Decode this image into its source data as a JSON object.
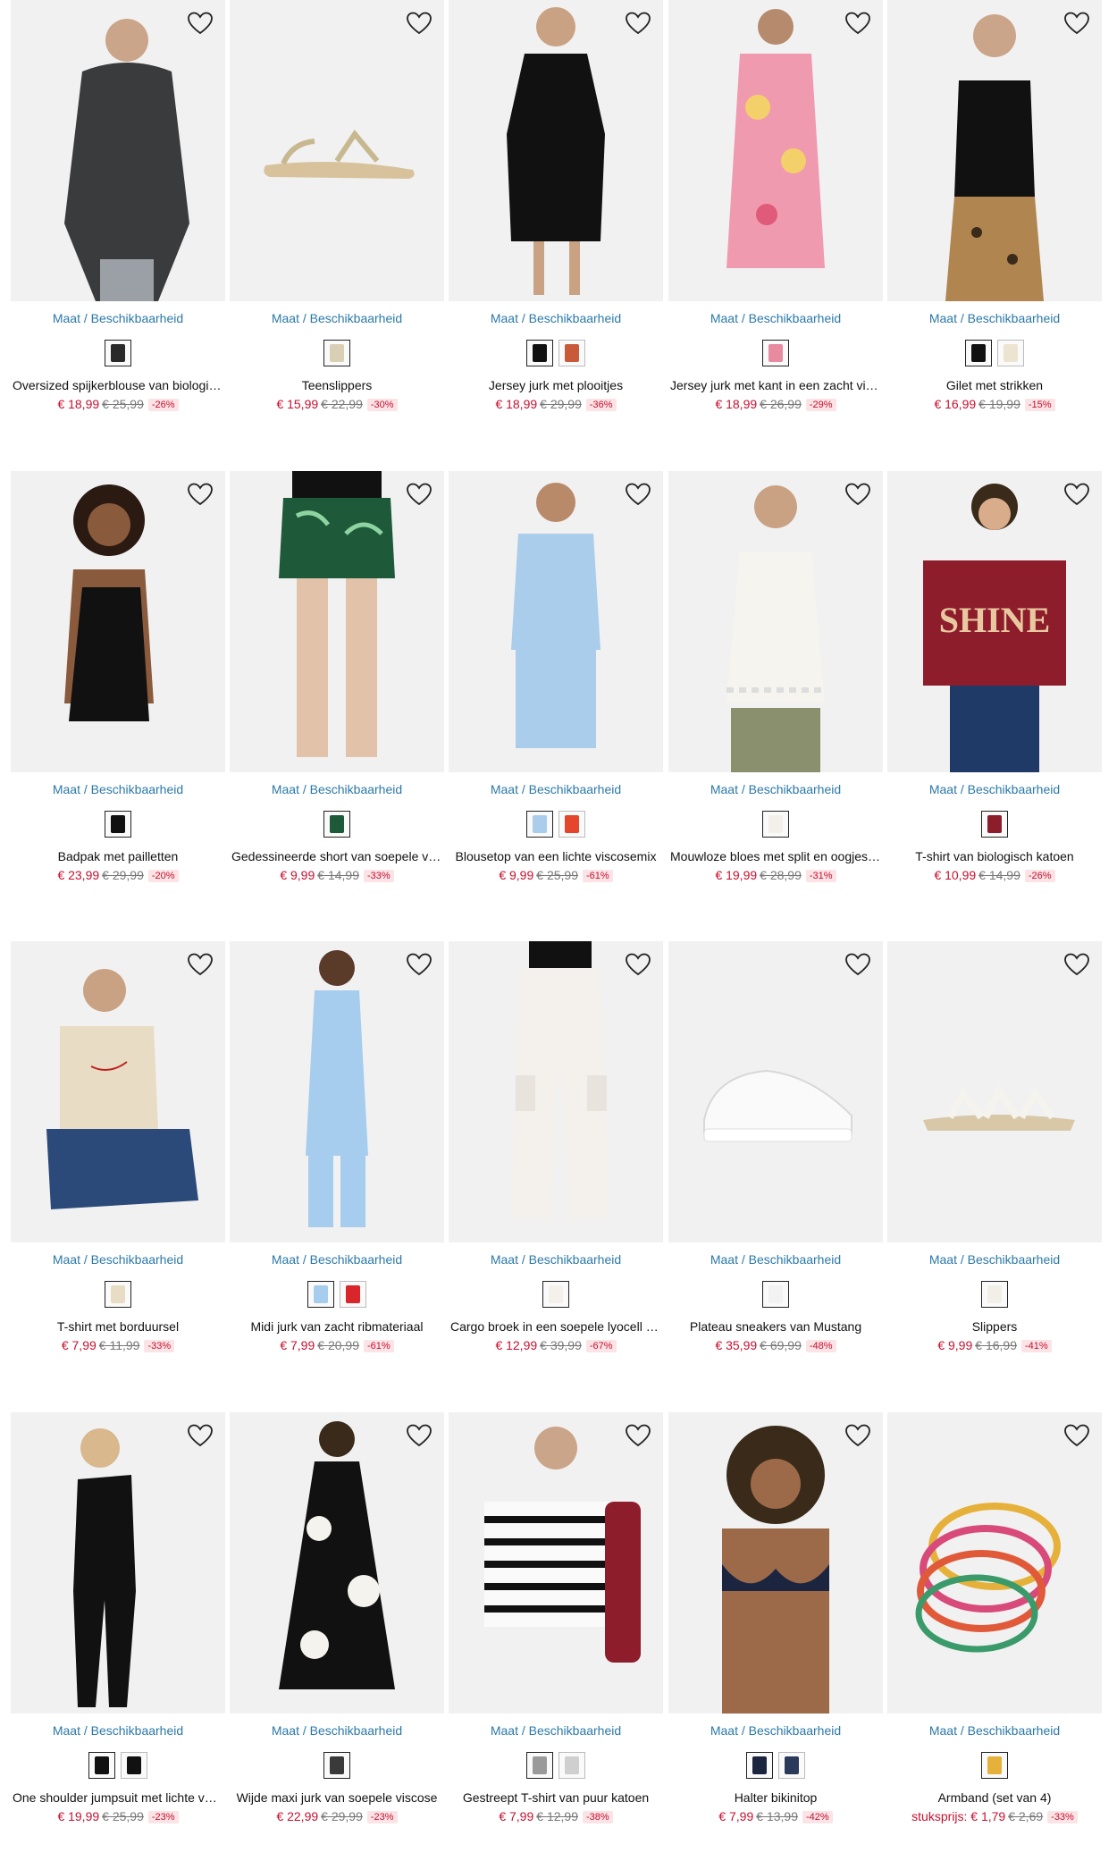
{
  "size_link_label": "Maat / Beschikbaarheid",
  "colors": {
    "sale": "#c8102e",
    "link": "#2b79a8"
  },
  "products": [
    {
      "name": "Oversized spijkerblouse van biologisch katoen",
      "price": "€ 18,99",
      "old_price": "€ 25,99",
      "discount": "-26%",
      "swatches": [
        "#2a2a2a"
      ],
      "icon": "oversized-denim-blouse-image"
    },
    {
      "name": "Teenslippers",
      "price": "€ 15,99",
      "old_price": "€ 22,99",
      "discount": "-30%",
      "swatches": [
        "#d9cfb5"
      ],
      "icon": "toe-sandals-image"
    },
    {
      "name": "Jersey jurk met plooitjes",
      "price": "€ 18,99",
      "old_price": "€ 29,99",
      "discount": "-36%",
      "swatches": [
        "#111111",
        "#c85a3a"
      ],
      "icon": "jersey-dress-image"
    },
    {
      "name": "Jersey jurk met kant in een zacht viscose",
      "price": "€ 18,99",
      "old_price": "€ 26,99",
      "discount": "-29%",
      "swatches": [
        "#e88aa0"
      ],
      "icon": "floral-dress-image"
    },
    {
      "name": "Gilet met strikken",
      "price": "€ 16,99",
      "old_price": "€ 19,99",
      "discount": "-15%",
      "swatches": [
        "#111111",
        "#ece4d0"
      ],
      "icon": "tie-vest-image"
    },
    {
      "name": "Badpak met pailletten",
      "price": "€ 23,99",
      "old_price": "€ 29,99",
      "discount": "-20%",
      "swatches": [
        "#111111"
      ],
      "icon": "swimsuit-image"
    },
    {
      "name": "Gedessineerde short van soepele viscose",
      "price": "€ 9,99",
      "old_price": "€ 14,99",
      "discount": "-33%",
      "swatches": [
        "#1e5a3a"
      ],
      "icon": "palm-shorts-image"
    },
    {
      "name": "Blousetop van een lichte viscosemix",
      "price": "€ 9,99",
      "old_price": "€ 25,99",
      "discount": "-61%",
      "swatches": [
        "#a9cdea",
        "#e5462b"
      ],
      "icon": "blouse-top-image"
    },
    {
      "name": "Mouwloze bloes met split en oogjes kant",
      "price": "€ 19,99",
      "old_price": "€ 28,99",
      "discount": "-31%",
      "swatches": [
        "#f3f0ea"
      ],
      "icon": "sleeveless-blouse-image"
    },
    {
      "name": "T-shirt van biologisch katoen",
      "price": "€ 10,99",
      "old_price": "€ 14,99",
      "discount": "-26%",
      "swatches": [
        "#8e1d2c"
      ],
      "icon": "shine-tshirt-image"
    },
    {
      "name": "T-shirt met borduursel",
      "price": "€ 7,99",
      "old_price": "€ 11,99",
      "discount": "-33%",
      "swatches": [
        "#e8ddc4"
      ],
      "icon": "embroidered-tshirt-image"
    },
    {
      "name": "Midi jurk van zacht ribmateriaal",
      "price": "€ 7,99",
      "old_price": "€ 20,99",
      "discount": "-61%",
      "swatches": [
        "#a6cdee",
        "#d8262a"
      ],
      "icon": "midi-dress-image"
    },
    {
      "name": "Cargo broek in een soepele lyocell mix",
      "price": "€ 12,99",
      "old_price": "€ 39,99",
      "discount": "-67%",
      "swatches": [
        "#f4f1ec"
      ],
      "icon": "cargo-pants-image"
    },
    {
      "name": "Plateau sneakers van Mustang",
      "price": "€ 35,99",
      "old_price": "€ 69,99",
      "discount": "-48%",
      "swatches": [
        "#f2f2f2"
      ],
      "icon": "platform-sneaker-image"
    },
    {
      "name": "Slippers",
      "price": "€ 9,99",
      "old_price": "€ 16,99",
      "discount": "-41%",
      "swatches": [
        "#f2efe8"
      ],
      "icon": "slippers-image"
    },
    {
      "name": "One shoulder jumpsuit met lichte volant",
      "price": "€ 19,99",
      "old_price": "€ 25,99",
      "discount": "-23%",
      "swatches": [
        "#111111",
        "#111111"
      ],
      "icon": "jumpsuit-image"
    },
    {
      "name": "Wijde maxi jurk van soepele viscose",
      "price": "€ 22,99",
      "old_price": "€ 29,99",
      "discount": "-23%",
      "swatches": [
        "#3a3a3a"
      ],
      "icon": "maxi-dress-image"
    },
    {
      "name": "Gestreept T-shirt van puur katoen",
      "price": "€ 7,99",
      "old_price": "€ 12,99",
      "discount": "-38%",
      "swatches": [
        "#9a9a9a",
        "#cfcfcf"
      ],
      "icon": "striped-tshirt-image"
    },
    {
      "name": "Halter bikinitop",
      "price": "€ 7,99",
      "old_price": "€ 13,99",
      "discount": "-42%",
      "swatches": [
        "#1c2540",
        "#2b3a5a"
      ],
      "icon": "bikini-top-image"
    },
    {
      "name": "Armband (set van 4)",
      "price_prefix": "stuksprijs: ",
      "price": "€ 1,79",
      "old_price": "€ 2,69",
      "discount": "-33%",
      "swatches": [
        "#e6b13a"
      ],
      "icon": "bracelet-set-image"
    }
  ]
}
